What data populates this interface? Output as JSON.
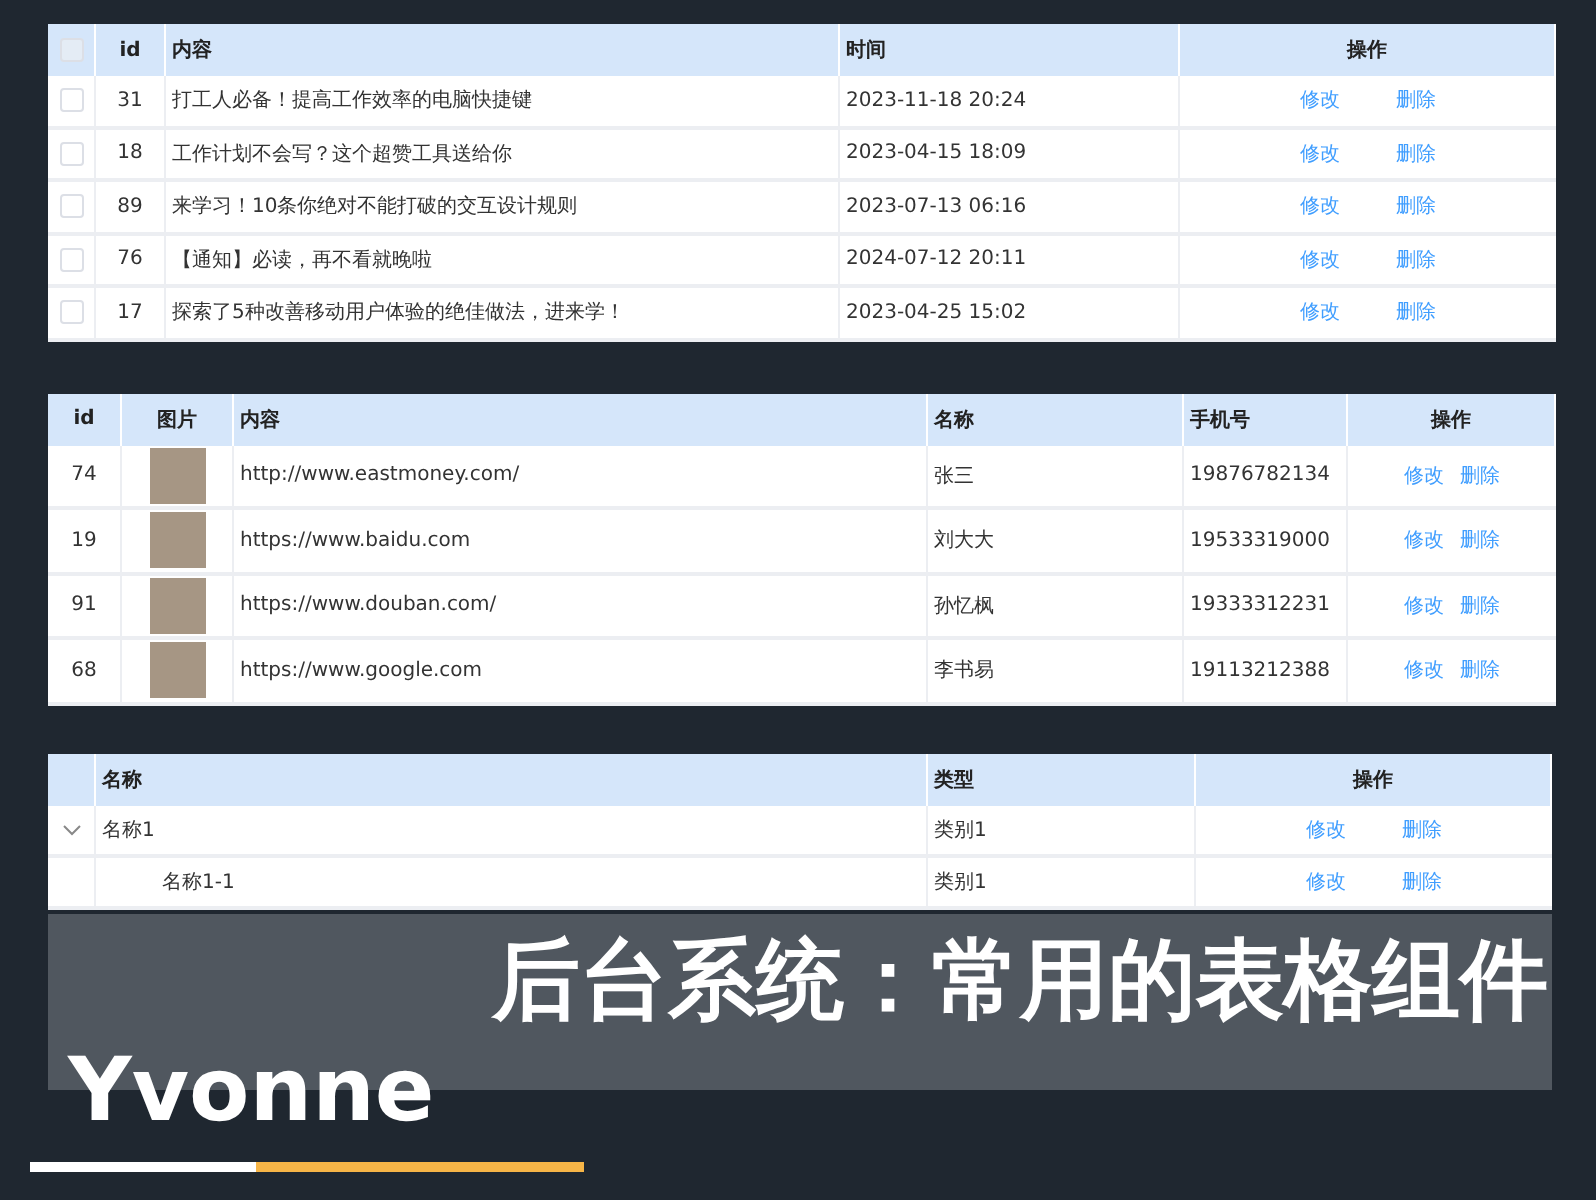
{
  "table_1": {
    "columns": [
      "id",
      "内容",
      "时间",
      "操作"
    ],
    "header_checkbox": {
      "checked": false
    },
    "rows": [
      {
        "checked": false,
        "id": "31",
        "content": "打工人必备！提高工作效率的电脑快捷键",
        "time": "2023-11-18 20:24",
        "actions": [
          "修改",
          "删除"
        ]
      },
      {
        "checked": false,
        "id": "18",
        "content": "工作计划不会写？这个超赞工具送给你",
        "time": "2023-04-15 18:09",
        "actions": [
          "修改",
          "删除"
        ]
      },
      {
        "checked": false,
        "id": "89",
        "content": "来学习！10条你绝对不能打破的交互设计规则",
        "time": "2023-07-13 06:16",
        "actions": [
          "修改",
          "删除"
        ]
      },
      {
        "checked": false,
        "id": "76",
        "content": "【通知】必读，再不看就晚啦",
        "time": "2024-07-12 20:11",
        "actions": [
          "修改",
          "删除"
        ]
      },
      {
        "checked": false,
        "id": "17",
        "content": "探索了5种改善移动用户体验的绝佳做法，进来学！",
        "time": "2023-04-25 15:02",
        "actions": [
          "修改",
          "删除"
        ]
      }
    ]
  },
  "table_2": {
    "columns": [
      "id",
      "图片",
      "内容",
      "名称",
      "手机号",
      "操作"
    ],
    "rows": [
      {
        "id": "74",
        "url": "http://www.eastmoney.com/",
        "name": "张三",
        "phone": "19876782134",
        "actions": [
          "修改",
          "删除"
        ]
      },
      {
        "id": "19",
        "url": "https://www.baidu.com",
        "name": "刘大大",
        "phone": "19533319000",
        "actions": [
          "修改",
          "删除"
        ]
      },
      {
        "id": "91",
        "url": "https://www.douban.com/",
        "name": "孙忆枫",
        "phone": "19333312231",
        "actions": [
          "修改",
          "删除"
        ]
      },
      {
        "id": "68",
        "url": "https://www.google.com",
        "name": "李书易",
        "phone": "19113212388",
        "actions": [
          "修改",
          "删除"
        ]
      }
    ]
  },
  "table_3": {
    "columns": [
      "名称",
      "类型",
      "操作"
    ],
    "rows": [
      {
        "name": "名称1",
        "type": "类别1",
        "actions": [
          "修改",
          "删除"
        ],
        "expanded": true,
        "children": [
          {
            "name": "名称1-1",
            "type": "类别1",
            "actions": [
              "修改",
              "删除"
            ]
          }
        ]
      }
    ]
  },
  "banner": {
    "title": "后台系统：常用的表格组件",
    "author": "Yvonne"
  }
}
